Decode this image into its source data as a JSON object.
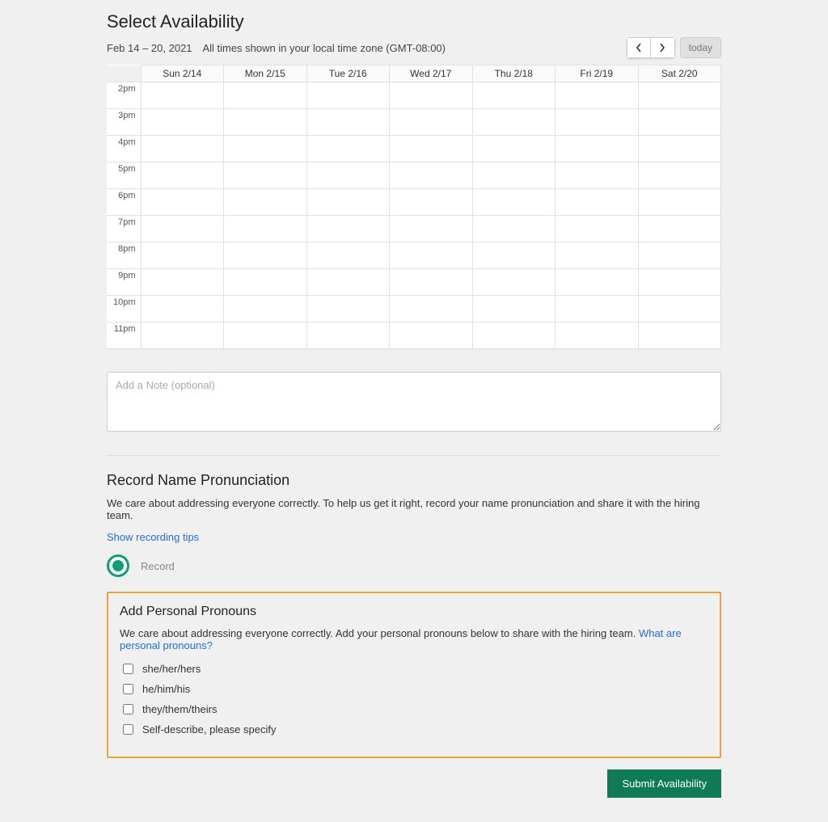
{
  "header": {
    "title": "Select Availability",
    "date_range": "Feb 14 – 20, 2021",
    "tz_note": "All times shown in your local time zone (GMT-08:00)",
    "today_label": "today"
  },
  "calendar": {
    "days": [
      "Sun 2/14",
      "Mon 2/15",
      "Tue 2/16",
      "Wed 2/17",
      "Thu 2/18",
      "Fri 2/19",
      "Sat 2/20"
    ],
    "hours": [
      "2pm",
      "3pm",
      "4pm",
      "5pm",
      "6pm",
      "7pm",
      "8pm",
      "9pm",
      "10pm",
      "11pm"
    ]
  },
  "note": {
    "placeholder": "Add a Note (optional)"
  },
  "pronunciation": {
    "title": "Record Name Pronunciation",
    "desc": "We care about addressing everyone correctly. To help us get it right, record your name pronunciation and share it with the hiring team.",
    "tips_link": "Show recording tips",
    "record_label": "Record"
  },
  "pronouns": {
    "title": "Add Personal Pronouns",
    "desc": "We care about addressing everyone correctly. Add your personal pronouns below to share with the hiring team. ",
    "info_link": "What are personal pronouns?",
    "options": [
      "she/her/hers",
      "he/him/his",
      "they/them/theirs",
      "Self-describe, please specify"
    ]
  },
  "footer": {
    "submit_label": "Submit Availability"
  }
}
